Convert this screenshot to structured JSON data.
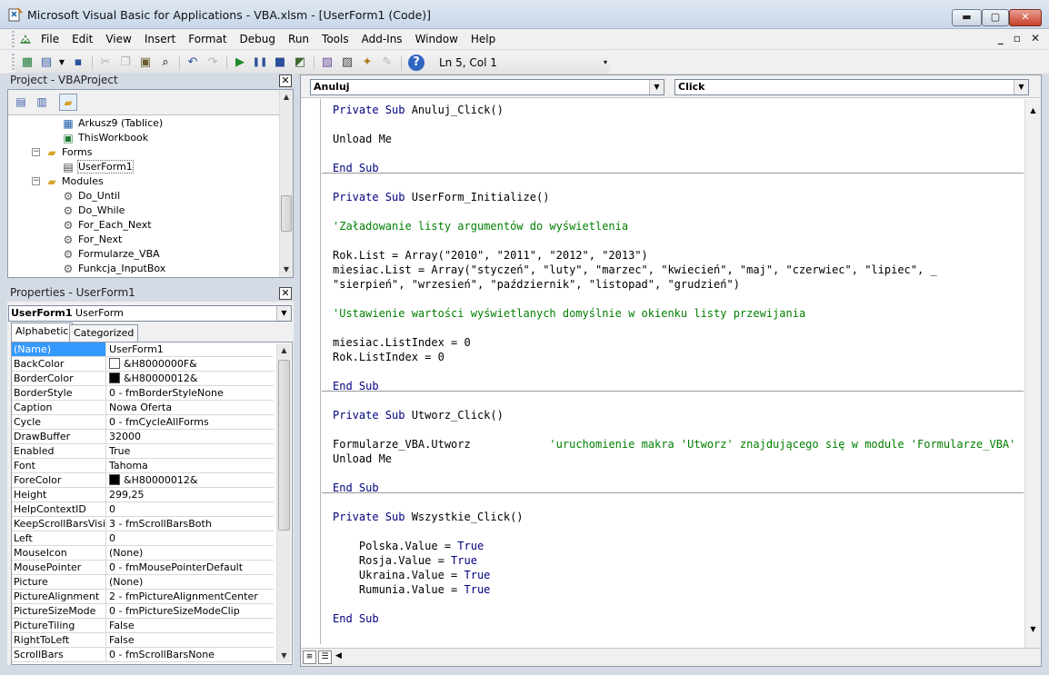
{
  "window": {
    "title": "Microsoft Visual Basic for Applications - VBA.xlsm - [UserForm1 (Code)]",
    "buttons": {
      "minimize": "▬",
      "maximize": "▢",
      "close": "✕"
    }
  },
  "menubar": {
    "items": [
      "File",
      "Edit",
      "View",
      "Insert",
      "Format",
      "Debug",
      "Run",
      "Tools",
      "Add-Ins",
      "Window",
      "Help"
    ],
    "mdi_buttons": [
      "_",
      "▫",
      "✕"
    ]
  },
  "toolbar": {
    "cursor_position": "Ln 5, Col 1",
    "icons": [
      "excel-icon",
      "insert-userform-icon",
      "save-icon",
      "cut-icon",
      "copy-icon",
      "paste-icon",
      "find-icon",
      "undo-icon",
      "redo-icon",
      "run-icon",
      "break-icon",
      "reset-icon",
      "design-mode-icon",
      "project-explorer-icon",
      "properties-window-icon",
      "object-browser-icon",
      "toolbox-icon",
      "help-icon"
    ]
  },
  "project": {
    "title": "Project - VBAProject",
    "close": "✕",
    "tree": [
      {
        "label": "Arkusz9 (Tablice)",
        "icon": "sheet-icon"
      },
      {
        "label": "ThisWorkbook",
        "icon": "workbook-icon"
      },
      {
        "label": "Forms",
        "icon": "folder-icon",
        "expander": "−"
      },
      {
        "label": "UserForm1",
        "icon": "form-icon"
      },
      {
        "label": "Modules",
        "icon": "folder-icon",
        "expander": "−"
      },
      {
        "label": "Do_Until",
        "icon": "module-icon"
      },
      {
        "label": "Do_While",
        "icon": "module-icon"
      },
      {
        "label": "For_Each_Next",
        "icon": "module-icon"
      },
      {
        "label": "For_Next",
        "icon": "module-icon"
      },
      {
        "label": "Formularze_VBA",
        "icon": "module-icon"
      },
      {
        "label": "Funkcja_InputBox",
        "icon": "module-icon"
      }
    ]
  },
  "properties": {
    "title": "Properties - UserForm1",
    "close": "✕",
    "object_name": "UserForm1",
    "object_type": "UserForm",
    "tabs": [
      "Alphabetic",
      "Categorized"
    ],
    "rows": [
      {
        "name": "(Name)",
        "value": "UserForm1"
      },
      {
        "name": "BackColor",
        "value": "&H8000000F&",
        "swatch": "#ffffff"
      },
      {
        "name": "BorderColor",
        "value": "&H80000012&",
        "swatch": "#000000"
      },
      {
        "name": "BorderStyle",
        "value": "0 - fmBorderStyleNone"
      },
      {
        "name": "Caption",
        "value": "Nowa Oferta"
      },
      {
        "name": "Cycle",
        "value": "0 - fmCycleAllForms"
      },
      {
        "name": "DrawBuffer",
        "value": "32000"
      },
      {
        "name": "Enabled",
        "value": "True"
      },
      {
        "name": "Font",
        "value": "Tahoma"
      },
      {
        "name": "ForeColor",
        "value": "&H80000012&",
        "swatch": "#000000"
      },
      {
        "name": "Height",
        "value": "299,25"
      },
      {
        "name": "HelpContextID",
        "value": "0"
      },
      {
        "name": "KeepScrollBarsVisible",
        "value": "3 - fmScrollBarsBoth"
      },
      {
        "name": "Left",
        "value": "0"
      },
      {
        "name": "MouseIcon",
        "value": "(None)"
      },
      {
        "name": "MousePointer",
        "value": "0 - fmMousePointerDefault"
      },
      {
        "name": "Picture",
        "value": "(None)"
      },
      {
        "name": "PictureAlignment",
        "value": "2 - fmPictureAlignmentCenter"
      },
      {
        "name": "PictureSizeMode",
        "value": "0 - fmPictureSizeModeClip"
      },
      {
        "name": "PictureTiling",
        "value": "False"
      },
      {
        "name": "RightToLeft",
        "value": "False"
      },
      {
        "name": "ScrollBars",
        "value": "0 - fmScrollBarsNone"
      }
    ]
  },
  "code": {
    "object_combo": "Anuluj",
    "procedure_combo": "Click",
    "lines": [
      [
        {
          "t": "Private Sub ",
          "c": "kw"
        },
        {
          "t": "Anuluj_Click()"
        }
      ],
      [],
      [
        {
          "t": "Unload Me"
        }
      ],
      [],
      [
        {
          "t": "End Sub",
          "c": "kw"
        }
      ],
      "sep",
      [
        {
          "t": "Private Sub ",
          "c": "kw"
        },
        {
          "t": "UserForm_Initialize()"
        }
      ],
      [],
      [
        {
          "t": "'Załadowanie listy argumentów do wyświetlenia",
          "c": "cm"
        }
      ],
      [],
      [
        {
          "t": "Rok.List = Array(\"2010\", \"2011\", \"2012\", \"2013\")"
        }
      ],
      [
        {
          "t": "miesiac.List = Array(\"styczeń\", \"luty\", \"marzec\", \"kwiecień\", \"maj\", \"czerwiec\", \"lipiec\", _"
        }
      ],
      [
        {
          "t": "\"sierpień\", \"wrzesień\", \"październik\", \"listopad\", \"grudzień\")"
        }
      ],
      [],
      [
        {
          "t": "'Ustawienie wartości wyświetlanych domyślnie w okienku listy przewijania",
          "c": "cm"
        }
      ],
      [],
      [
        {
          "t": "miesiac.ListIndex = 0"
        }
      ],
      [
        {
          "t": "Rok.ListIndex = 0"
        }
      ],
      [],
      [
        {
          "t": "End Sub",
          "c": "kw"
        }
      ],
      "sep",
      [
        {
          "t": "Private Sub ",
          "c": "kw"
        },
        {
          "t": "Utworz_Click()"
        }
      ],
      [],
      [
        {
          "t": "Formularze_VBA.Utworz            "
        },
        {
          "t": "'uruchomienie makra 'Utworz' znajdującego się w module 'Formularze_VBA'",
          "c": "cm"
        }
      ],
      [
        {
          "t": "Unload Me"
        }
      ],
      [],
      [
        {
          "t": "End Sub",
          "c": "kw"
        }
      ],
      "sep",
      [
        {
          "t": "Private Sub ",
          "c": "kw"
        },
        {
          "t": "Wszystkie_Click()"
        }
      ],
      [],
      [
        {
          "t": "    Polska.Value = "
        },
        {
          "t": "True",
          "c": "kw"
        }
      ],
      [
        {
          "t": "    Rosja.Value = "
        },
        {
          "t": "True",
          "c": "kw"
        }
      ],
      [
        {
          "t": "    Ukraina.Value = "
        },
        {
          "t": "True",
          "c": "kw"
        }
      ],
      [
        {
          "t": "    Rumunia.Value = "
        },
        {
          "t": "True",
          "c": "kw"
        }
      ],
      [],
      [
        {
          "t": "End Sub",
          "c": "kw"
        }
      ]
    ]
  },
  "colors": {
    "keyword": "#00007f",
    "comment": "#007f00",
    "selection": "#3399ff"
  }
}
